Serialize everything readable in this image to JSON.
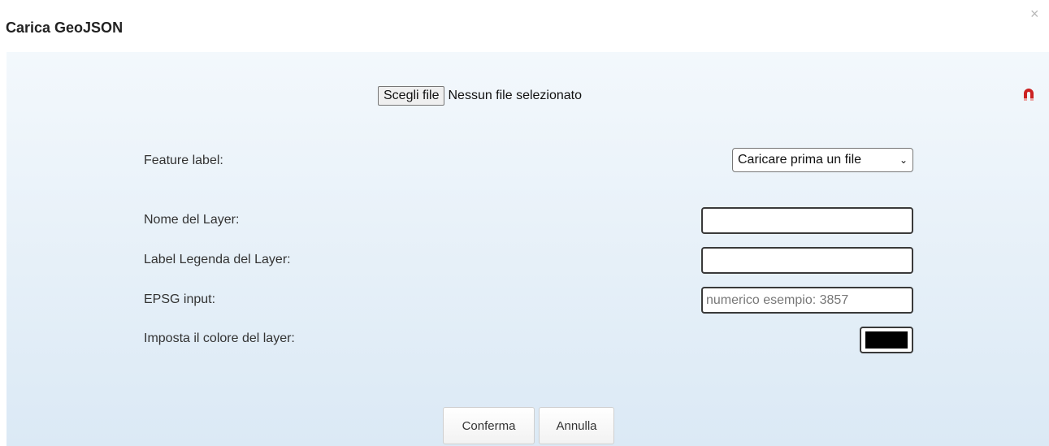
{
  "dialog": {
    "title": "Carica GeoJSON",
    "close_icon": "×"
  },
  "file": {
    "button_label": "Scegli file",
    "status": "Nessun file selezionato"
  },
  "fields": {
    "feature_label": "Feature label:",
    "feature_select_value": "Caricare prima un file",
    "layer_name_label": "Nome del Layer:",
    "layer_name_value": "",
    "legend_label": "Label Legenda del Layer:",
    "legend_value": "",
    "epsg_label": "EPSG input:",
    "epsg_placeholder": "numerico esempio: 3857",
    "color_label": "Imposta il colore del layer:",
    "color_value": "#000000"
  },
  "buttons": {
    "confirm": "Conferma",
    "cancel": "Annulla"
  },
  "icons": {
    "magnet": "magnet-icon",
    "close": "close-icon",
    "dropdown": "chevron-down-icon"
  },
  "colors": {
    "accent_magnet": "#cc2222",
    "body_top": "#f3f8fc",
    "body_bottom": "#dbe9f5"
  }
}
